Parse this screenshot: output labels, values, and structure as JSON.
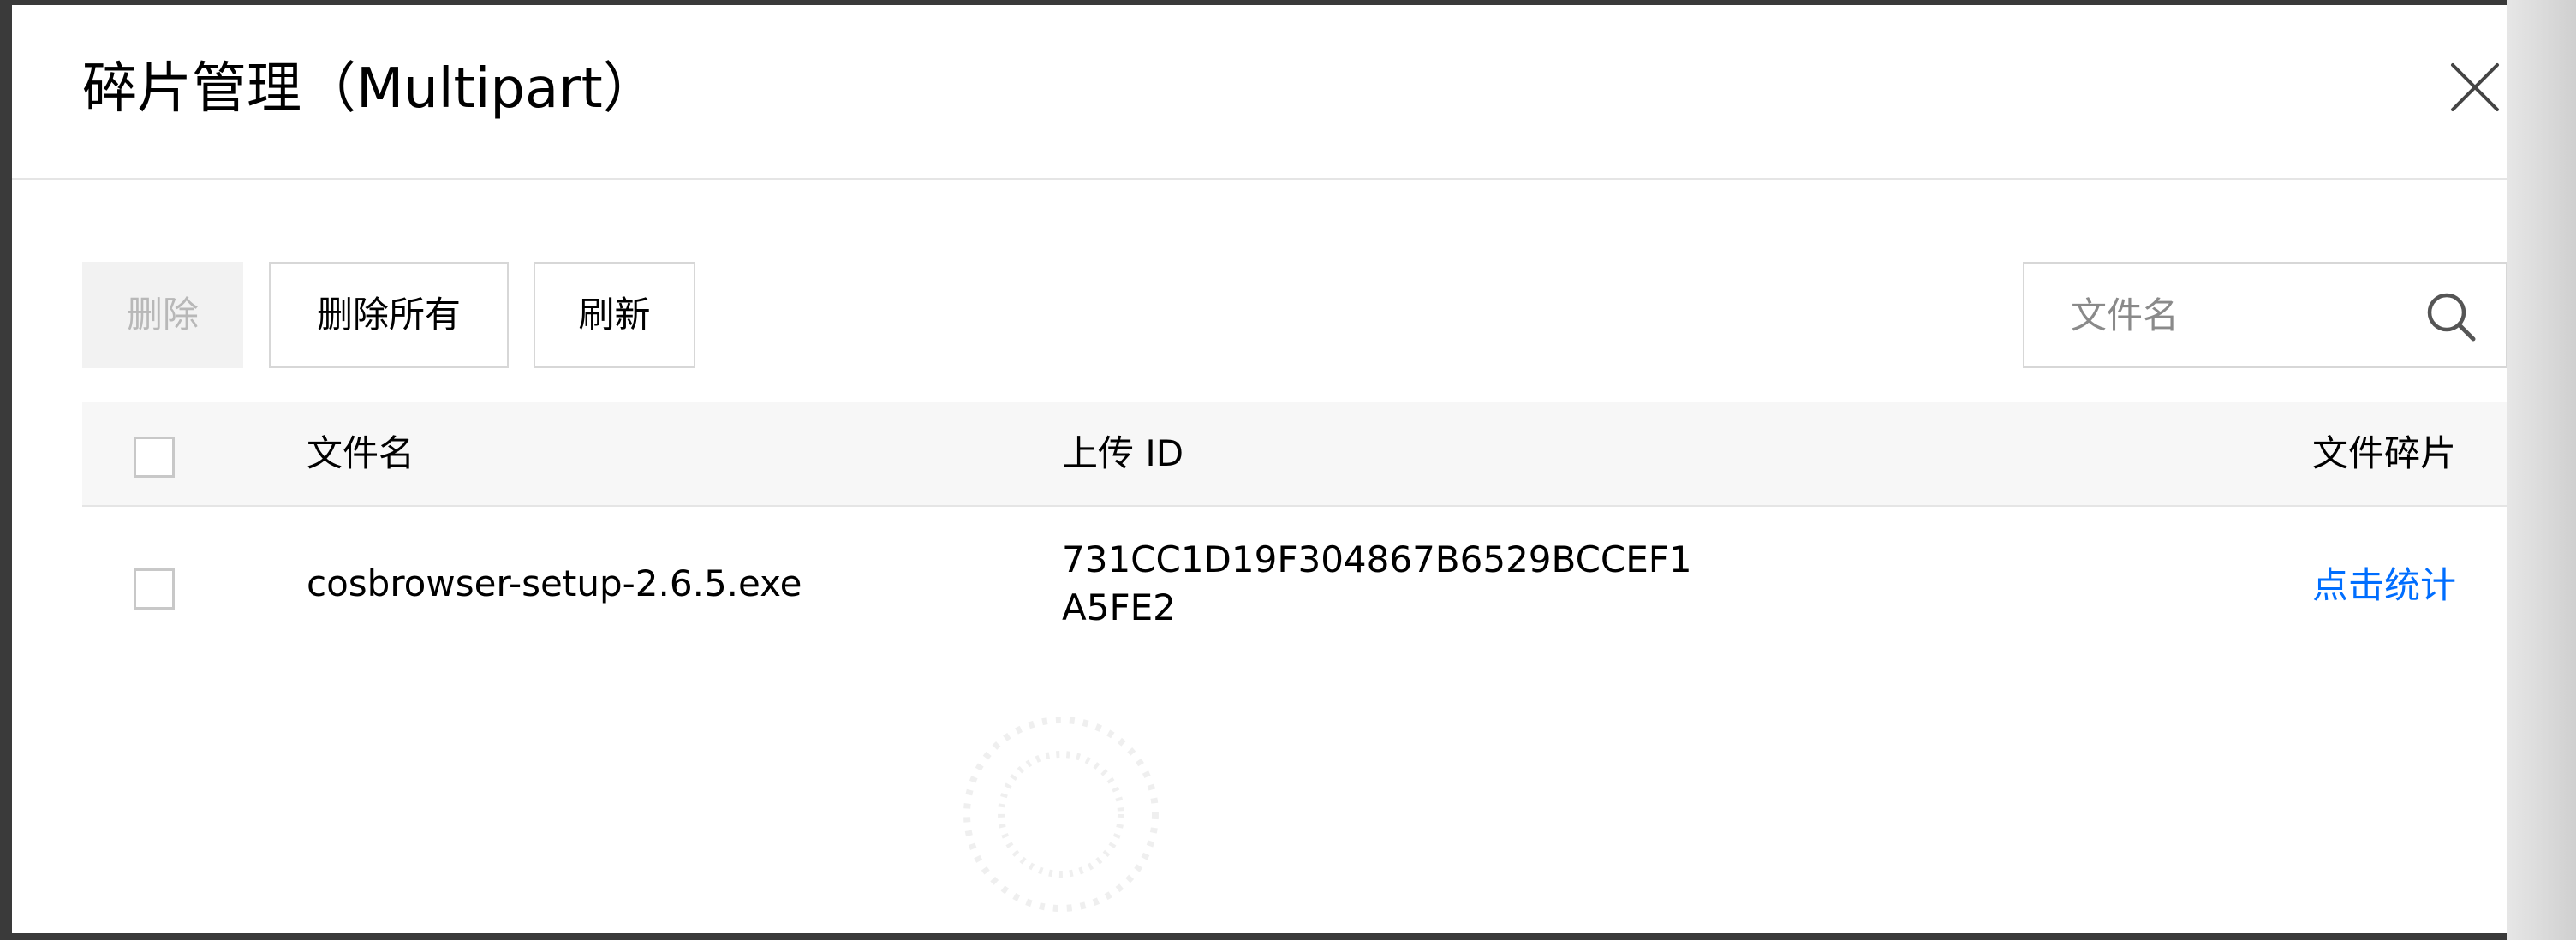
{
  "dialog": {
    "title": "碎片管理（Multipart）"
  },
  "toolbar": {
    "delete_label": "删除",
    "delete_all_label": "删除所有",
    "refresh_label": "刷新"
  },
  "search": {
    "placeholder": "文件名",
    "value": ""
  },
  "table": {
    "columns": {
      "filename": "文件名",
      "upload_id": "上传 ID",
      "fragments": "文件碎片"
    },
    "rows": [
      {
        "filename": "cosbrowser-setup-2.6.5.exe",
        "upload_id": "731CC1D19F304867B6529BCCEF1A5FE2",
        "action": "点击统计",
        "selected": false
      }
    ]
  },
  "icons": {
    "close": "close-icon",
    "search": "search-icon"
  },
  "colors": {
    "link": "#006eff",
    "disabled_text": "#b8b8b8",
    "disabled_bg": "#f2f2f2",
    "border": "#d7d7d7",
    "header_bg": "#f7f7f7"
  }
}
